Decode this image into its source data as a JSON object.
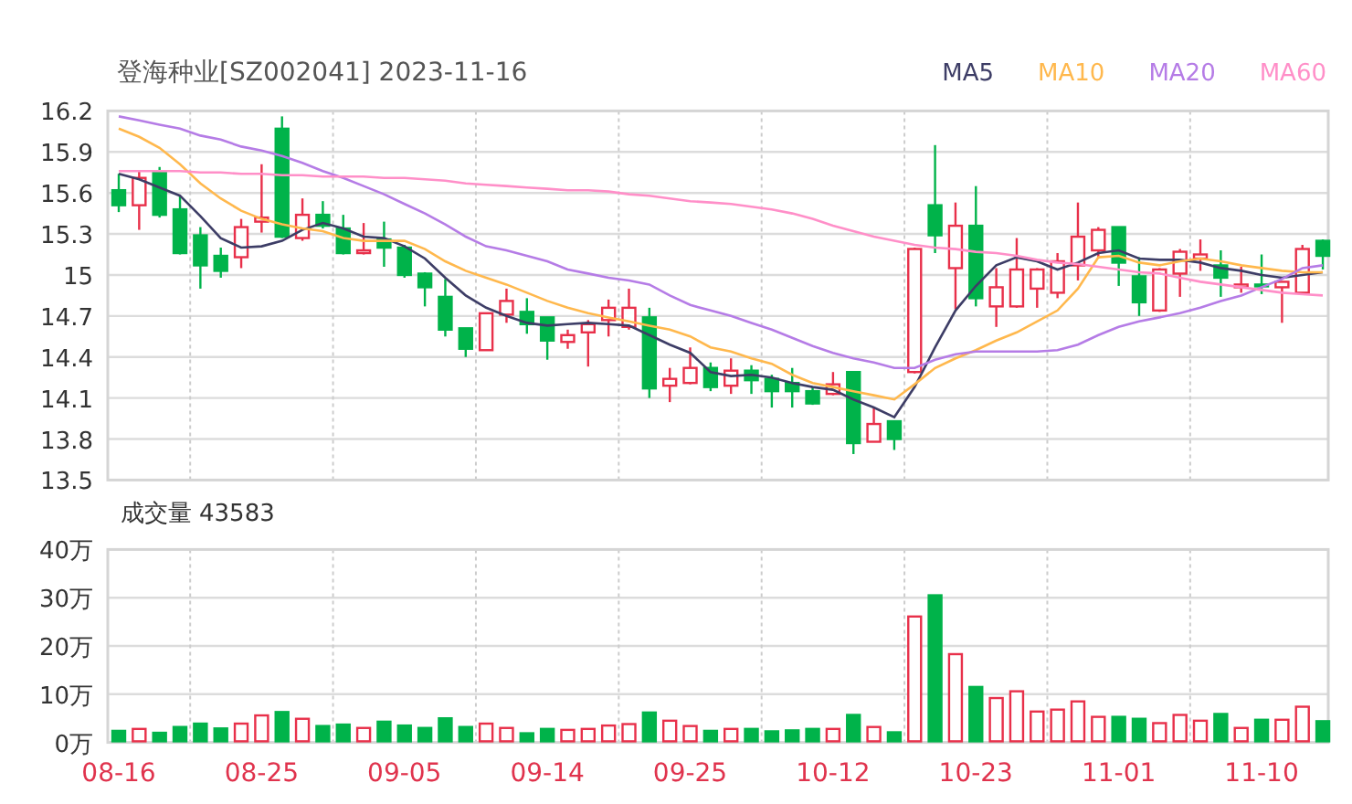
{
  "header": {
    "title": "登海种业[SZ002041] 2023-11-16"
  },
  "price_chart": {
    "chart_data": {
      "type": "candlestick",
      "grid": true,
      "ylim": [
        13.5,
        16.2
      ],
      "yticks": [
        13.5,
        13.8,
        14.1,
        14.4,
        14.7,
        15,
        15.3,
        15.6,
        15.9,
        16.2
      ],
      "ohlc": [
        [
          15.62,
          15.74,
          15.46,
          15.51
        ],
        [
          15.51,
          15.76,
          15.33,
          15.71
        ],
        [
          15.76,
          15.79,
          15.42,
          15.44
        ],
        [
          15.48,
          15.58,
          15.15,
          15.16
        ],
        [
          15.29,
          15.35,
          14.9,
          15.07
        ],
        [
          15.14,
          15.2,
          14.98,
          15.03
        ],
        [
          15.13,
          15.41,
          15.05,
          15.35
        ],
        [
          15.39,
          15.81,
          15.31,
          15.42
        ],
        [
          16.07,
          16.16,
          15.27,
          15.28
        ],
        [
          15.27,
          15.56,
          15.25,
          15.44
        ],
        [
          15.44,
          15.54,
          15.34,
          15.36
        ],
        [
          15.34,
          15.44,
          15.15,
          15.16
        ],
        [
          15.16,
          15.38,
          15.15,
          15.18
        ],
        [
          15.26,
          15.39,
          15.06,
          15.2
        ],
        [
          15.2,
          15.22,
          14.98,
          15.0
        ],
        [
          15.01,
          15.02,
          14.77,
          14.91
        ],
        [
          14.84,
          14.97,
          14.55,
          14.6
        ],
        [
          14.61,
          14.61,
          14.4,
          14.46
        ],
        [
          14.45,
          14.72,
          14.45,
          14.72
        ],
        [
          14.71,
          14.9,
          14.65,
          14.81
        ],
        [
          14.73,
          14.83,
          14.57,
          14.64
        ],
        [
          14.69,
          14.69,
          14.38,
          14.52
        ],
        [
          14.51,
          14.6,
          14.46,
          14.56
        ],
        [
          14.58,
          14.67,
          14.33,
          14.64
        ],
        [
          14.67,
          14.82,
          14.55,
          14.76
        ],
        [
          14.62,
          14.9,
          14.6,
          14.76
        ],
        [
          14.69,
          14.76,
          14.1,
          14.17
        ],
        [
          14.19,
          14.32,
          14.07,
          14.24
        ],
        [
          14.21,
          14.47,
          14.2,
          14.32
        ],
        [
          14.32,
          14.36,
          14.15,
          14.18
        ],
        [
          14.19,
          14.39,
          14.13,
          14.3
        ],
        [
          14.3,
          14.34,
          14.13,
          14.23
        ],
        [
          14.24,
          14.27,
          14.03,
          14.15
        ],
        [
          14.21,
          14.32,
          14.03,
          14.15
        ],
        [
          14.15,
          14.18,
          14.05,
          14.06
        ],
        [
          14.13,
          14.29,
          14.12,
          14.2
        ],
        [
          14.29,
          14.29,
          13.69,
          13.77
        ],
        [
          13.78,
          14.03,
          13.78,
          13.91
        ],
        [
          13.93,
          13.93,
          13.72,
          13.8
        ],
        [
          14.29,
          15.2,
          14.28,
          15.19
        ],
        [
          15.51,
          15.95,
          15.16,
          15.29
        ],
        [
          15.05,
          15.53,
          14.75,
          15.36
        ],
        [
          15.36,
          15.65,
          14.77,
          14.83
        ],
        [
          14.77,
          15.05,
          14.62,
          14.91
        ],
        [
          14.77,
          15.27,
          14.76,
          15.04
        ],
        [
          14.9,
          15.05,
          14.76,
          15.04
        ],
        [
          14.87,
          15.16,
          14.83,
          15.1
        ],
        [
          15.07,
          15.53,
          14.96,
          15.28
        ],
        [
          15.18,
          15.35,
          15.12,
          15.33
        ],
        [
          15.35,
          15.35,
          14.92,
          15.09
        ],
        [
          14.99,
          15.13,
          14.7,
          14.8
        ],
        [
          14.74,
          15.05,
          14.73,
          15.04
        ],
        [
          15.01,
          15.19,
          14.84,
          15.17
        ],
        [
          15.12,
          15.26,
          15.03,
          15.15
        ],
        [
          15.07,
          15.18,
          14.84,
          14.98
        ],
        [
          14.91,
          15.06,
          14.87,
          14.93
        ],
        [
          14.93,
          15.15,
          14.86,
          14.92
        ],
        [
          14.91,
          14.95,
          14.65,
          14.95
        ],
        [
          14.87,
          15.22,
          14.86,
          15.19
        ],
        [
          15.25,
          15.26,
          15.04,
          15.14
        ]
      ],
      "series": [
        {
          "name": "MA5",
          "type": "line",
          "color": "#3d3d66",
          "values": [
            15.74,
            15.7,
            15.64,
            15.58,
            15.43,
            15.27,
            15.2,
            15.21,
            15.25,
            15.33,
            15.38,
            15.34,
            15.28,
            15.27,
            15.21,
            15.12,
            14.98,
            14.85,
            14.76,
            14.7,
            14.65,
            14.63,
            14.64,
            14.65,
            14.64,
            14.63,
            14.56,
            14.49,
            14.43,
            14.29,
            14.26,
            14.27,
            14.25,
            14.21,
            14.18,
            14.16,
            14.09,
            14.03,
            13.96,
            14.18,
            14.47,
            14.74,
            14.92,
            15.07,
            15.13,
            15.1,
            15.04,
            15.09,
            15.16,
            15.18,
            15.12,
            15.11,
            15.11,
            15.09,
            15.05,
            15.03,
            15.0,
            14.98,
            15.0,
            15.02
          ]
        },
        {
          "name": "MA10",
          "type": "line",
          "color": "#ffb84d",
          "values": [
            16.07,
            16.01,
            15.93,
            15.81,
            15.67,
            15.56,
            15.47,
            15.41,
            15.37,
            15.34,
            15.32,
            15.27,
            15.25,
            15.25,
            15.25,
            15.19,
            15.1,
            15.03,
            14.98,
            14.93,
            14.87,
            14.81,
            14.76,
            14.72,
            14.69,
            14.66,
            14.63,
            14.6,
            14.55,
            14.47,
            14.44,
            14.39,
            14.35,
            14.27,
            14.21,
            14.18,
            14.15,
            14.12,
            14.09,
            14.2,
            14.32,
            14.39,
            14.45,
            14.52,
            14.58,
            14.66,
            14.74,
            14.9,
            15.13,
            15.14,
            15.09,
            15.07,
            15.1,
            15.12,
            15.1,
            15.07,
            15.05,
            15.03,
            15.02,
            15.02
          ]
        },
        {
          "name": "MA20",
          "type": "line",
          "color": "#b57ce6",
          "values": [
            16.16,
            16.13,
            16.1,
            16.07,
            16.02,
            15.99,
            15.94,
            15.91,
            15.87,
            15.82,
            15.76,
            15.71,
            15.65,
            15.59,
            15.52,
            15.45,
            15.37,
            15.28,
            15.21,
            15.18,
            15.14,
            15.1,
            15.04,
            15.01,
            14.98,
            14.96,
            14.93,
            14.85,
            14.78,
            14.74,
            14.7,
            14.65,
            14.6,
            14.54,
            14.48,
            14.43,
            14.39,
            14.36,
            14.32,
            14.32,
            14.38,
            14.42,
            14.44,
            14.44,
            14.44,
            14.44,
            14.45,
            14.49,
            14.56,
            14.62,
            14.66,
            14.69,
            14.72,
            14.76,
            14.81,
            14.85,
            14.91,
            14.97,
            15.05,
            15.07
          ]
        },
        {
          "name": "MA60",
          "type": "line",
          "color": "#ff8fc8",
          "values": [
            15.76,
            15.76,
            15.76,
            15.76,
            15.75,
            15.75,
            15.74,
            15.74,
            15.73,
            15.73,
            15.72,
            15.72,
            15.72,
            15.71,
            15.71,
            15.7,
            15.69,
            15.67,
            15.66,
            15.65,
            15.64,
            15.63,
            15.62,
            15.62,
            15.61,
            15.59,
            15.58,
            15.56,
            15.54,
            15.53,
            15.52,
            15.5,
            15.48,
            15.45,
            15.41,
            15.36,
            15.32,
            15.28,
            15.25,
            15.22,
            15.2,
            15.19,
            15.17,
            15.16,
            15.14,
            15.11,
            15.09,
            15.08,
            15.06,
            15.04,
            15.02,
            15.01,
            14.98,
            14.95,
            14.93,
            14.91,
            14.89,
            14.87,
            14.86,
            14.85
          ]
        }
      ]
    }
  },
  "volume_chart": {
    "title": "成交量",
    "reading": "43583",
    "chart_data": {
      "type": "bar",
      "grid": true,
      "ylim": [
        0,
        40
      ],
      "categories": [
        "08-16",
        null,
        null,
        null,
        null,
        null,
        null,
        "08-25",
        null,
        null,
        null,
        null,
        null,
        null,
        "09-05",
        null,
        null,
        null,
        null,
        null,
        null,
        "09-14",
        null,
        null,
        null,
        null,
        null,
        null,
        "09-25",
        null,
        null,
        null,
        null,
        null,
        null,
        "10-12",
        null,
        null,
        null,
        null,
        null,
        null,
        "10-23",
        null,
        null,
        null,
        null,
        null,
        null,
        "11-01",
        null,
        null,
        null,
        null,
        null,
        null,
        "11-10",
        null,
        null,
        null
      ],
      "yticks": [
        {
          "value": 0,
          "label": "0万"
        },
        {
          "value": 10,
          "label": "10万"
        },
        {
          "value": 20,
          "label": "20万"
        },
        {
          "value": 30,
          "label": "30万"
        },
        {
          "value": 40,
          "label": "40万"
        }
      ],
      "values": [
        2.4,
        2.8,
        2.0,
        3.2,
        3.9,
        2.9,
        3.9,
        5.6,
        6.3,
        4.9,
        3.4,
        3.7,
        3.0,
        4.3,
        3.5,
        3.0,
        5.0,
        3.2,
        3.9,
        3.0,
        1.9,
        2.8,
        2.6,
        2.8,
        3.5,
        3.8,
        6.2,
        4.5,
        3.4,
        2.4,
        2.8,
        2.8,
        2.3,
        2.5,
        2.8,
        2.8,
        5.7,
        3.2,
        2.1,
        26.1,
        30.5,
        18.3,
        11.5,
        9.2,
        10.6,
        6.4,
        6.8,
        8.5,
        5.3,
        5.3,
        4.9,
        4.0,
        5.7,
        4.5,
        5.9,
        3.0,
        4.7,
        4.7,
        7.4,
        4.4
      ]
    }
  }
}
